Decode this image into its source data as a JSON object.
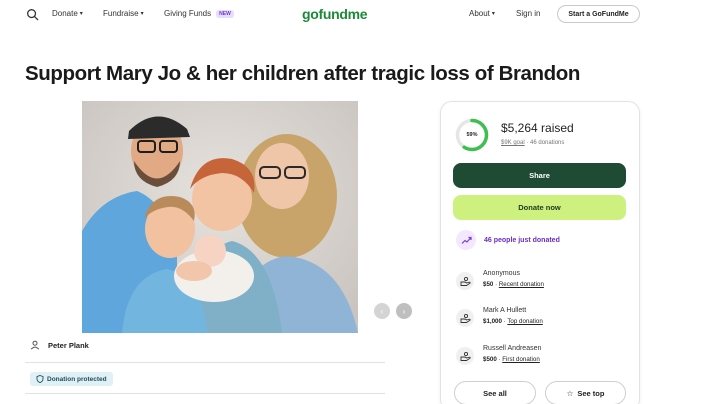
{
  "nav": {
    "search_icon": "search-icon",
    "donate": "Donate",
    "fundraise": "Fundraise",
    "giving_funds": "Giving Funds",
    "new_badge": "NEW",
    "logo": "gofundme",
    "about": "About",
    "sign_in": "Sign in",
    "start": "Start a GoFundMe"
  },
  "campaign": {
    "title": "Support Mary Jo & her children after tragic loss of Brandon",
    "photo_alt": "Family photo",
    "organizer": "Peter Plank",
    "protected": "Donation protected"
  },
  "donation": {
    "progress_percent": 59,
    "progress_label": "59%",
    "raised": "$5,264 raised",
    "goal": "$9K goal",
    "donations": "46 donations",
    "share": "Share",
    "donate_now": "Donate now",
    "recent_activity": "46 people just donated",
    "donors": [
      {
        "name": "Anonymous",
        "amount": "$50",
        "kind": "Recent donation"
      },
      {
        "name": "Mark A Hullett",
        "amount": "$1,000",
        "kind": "Top donation"
      },
      {
        "name": "Russell Andreasen",
        "amount": "$500",
        "kind": "First donation"
      }
    ],
    "see_all": "See all",
    "see_top": "See top"
  },
  "colors": {
    "brand_green": "#1b8a3a",
    "share_bg": "#1f4a33",
    "donate_bg": "#cdf07f",
    "activity_purple": "#6a2fc4",
    "progress_ring": "#3fbf4f"
  }
}
